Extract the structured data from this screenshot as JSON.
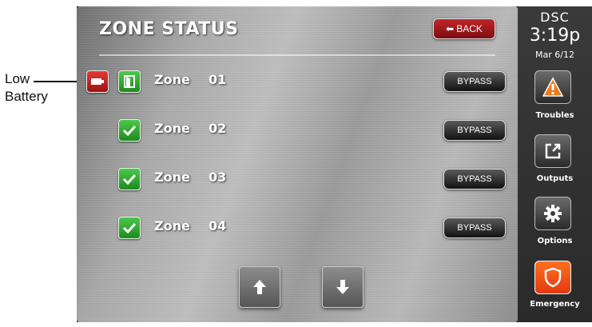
{
  "annotation": {
    "line1": "Low",
    "line2": "Battery"
  },
  "header": {
    "title": "ZONE STATUS",
    "back_label": "BACK"
  },
  "zones": [
    {
      "word": "Zone",
      "number": "01",
      "status_icon": "door-open-icon",
      "low_battery": true,
      "bypass_label": "BYPASS"
    },
    {
      "word": "Zone",
      "number": "02",
      "status_icon": "checkmark-icon",
      "low_battery": false,
      "bypass_label": "BYPASS"
    },
    {
      "word": "Zone",
      "number": "03",
      "status_icon": "checkmark-icon",
      "low_battery": false,
      "bypass_label": "BYPASS"
    },
    {
      "word": "Zone",
      "number": "04",
      "status_icon": "checkmark-icon",
      "low_battery": false,
      "bypass_label": "BYPASS"
    }
  ],
  "paging": {
    "up_icon": "arrow-up-icon",
    "down_icon": "arrow-down-icon"
  },
  "sidebar": {
    "brand": "DSC",
    "time": "3:19p",
    "date": "Mar 6/12",
    "buttons": [
      {
        "label": "Troubles",
        "icon": "warning-icon"
      },
      {
        "label": "Outputs",
        "icon": "external-link-icon"
      },
      {
        "label": "Options",
        "icon": "gear-icon"
      },
      {
        "label": "Emergency",
        "icon": "shield-icon"
      }
    ]
  },
  "colors": {
    "back_button": "#a81a1e",
    "status_green": "#2ea82e",
    "battery_red": "#c62828",
    "warning_orange": "#f07a1a",
    "emergency_orange": "#f05a18",
    "sidebar_bg": "#333333"
  }
}
